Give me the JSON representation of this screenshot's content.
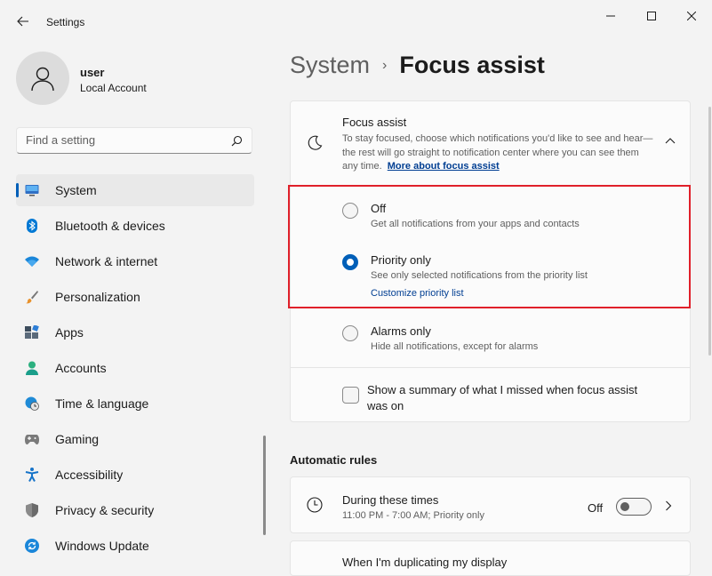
{
  "window": {
    "title": "Settings",
    "controls": {
      "minimize": "minimize-icon",
      "maximize": "maximize-icon",
      "close": "close-icon"
    }
  },
  "profile": {
    "name": "user",
    "account_type": "Local Account"
  },
  "search": {
    "placeholder": "Find a setting",
    "value": ""
  },
  "sidebar": {
    "items": [
      {
        "label": "System",
        "icon": "monitor-icon",
        "selected": true
      },
      {
        "label": "Bluetooth & devices",
        "icon": "bluetooth-icon"
      },
      {
        "label": "Network & internet",
        "icon": "wifi-icon"
      },
      {
        "label": "Personalization",
        "icon": "brush-icon"
      },
      {
        "label": "Apps",
        "icon": "apps-icon"
      },
      {
        "label": "Accounts",
        "icon": "person-icon"
      },
      {
        "label": "Time & language",
        "icon": "globe-clock-icon"
      },
      {
        "label": "Gaming",
        "icon": "gamepad-icon"
      },
      {
        "label": "Accessibility",
        "icon": "accessibility-icon"
      },
      {
        "label": "Privacy & security",
        "icon": "shield-icon"
      },
      {
        "label": "Windows Update",
        "icon": "update-icon"
      }
    ]
  },
  "breadcrumb": {
    "parent": "System",
    "separator": "›",
    "current": "Focus assist"
  },
  "focus_assist": {
    "title": "Focus assist",
    "description": "To stay focused, choose which notifications you'd like to see and hear—the rest will go straight to notification center where you can see them any time.",
    "link": "More about focus assist",
    "options": [
      {
        "title": "Off",
        "subtitle": "Get all notifications from your apps and contacts",
        "checked": false
      },
      {
        "title": "Priority only",
        "subtitle": "See only selected notifications from the priority list",
        "link": "Customize priority list",
        "checked": true
      },
      {
        "title": "Alarms only",
        "subtitle": "Hide all notifications, except for alarms",
        "checked": false
      }
    ],
    "summary_checkbox": {
      "label": "Show a summary of what I missed when focus assist was on",
      "checked": false
    }
  },
  "automatic_rules": {
    "title": "Automatic rules",
    "rules": [
      {
        "title": "During these times",
        "subtitle": "11:00 PM - 7:00 AM; Priority only",
        "state": "Off",
        "enabled": false
      },
      {
        "title": "When I'm duplicating my display"
      }
    ]
  },
  "colors": {
    "accent": "#005fb8",
    "highlight": "#e0202a",
    "link": "#003e92"
  }
}
